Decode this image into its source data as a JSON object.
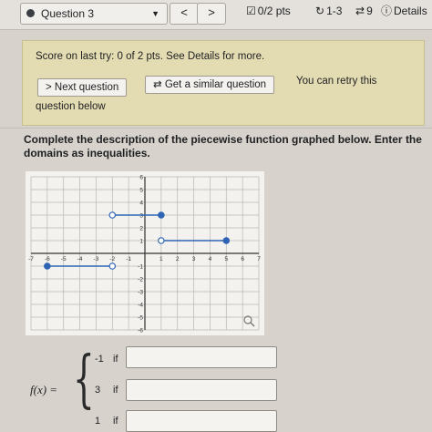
{
  "topbar": {
    "question_label": "Question 3",
    "prev_symbol": "<",
    "next_symbol": ">",
    "points": "0/2 pts",
    "attempts": "1-3",
    "retries": "9",
    "details": "Details"
  },
  "feedback": {
    "score_text": "Score on last try: 0 of 2 pts. See Details for more.",
    "next_question_label": "> Next question",
    "similar_question_label": "Get a similar question",
    "retry_text_line1": "You can retry this",
    "retry_text_line2": "question below"
  },
  "prompt": {
    "line1": "Complete the description of the piecewise function graphed below. Enter the",
    "line2": "domains as inequalities."
  },
  "graph": {
    "x_ticks": [
      "-7",
      "-6",
      "-5",
      "-4",
      "-3",
      "-2",
      "-1",
      "1",
      "2",
      "3",
      "4",
      "5",
      "6",
      "7"
    ],
    "y_ticks": [
      "6",
      "5",
      "4",
      "3",
      "2",
      "1",
      "-1",
      "-2",
      "-3",
      "-4",
      "-5",
      "-6"
    ]
  },
  "chart_data": {
    "type": "line",
    "xlim": [
      -7,
      7
    ],
    "ylim": [
      -6,
      6
    ],
    "grid": true,
    "segments": [
      {
        "x": [
          -6,
          -2
        ],
        "y": [
          -1,
          -1
        ],
        "left_closed": true,
        "right_closed": false
      },
      {
        "x": [
          -2,
          1
        ],
        "y": [
          3,
          3
        ],
        "left_closed": false,
        "right_closed": true
      },
      {
        "x": [
          1,
          5
        ],
        "y": [
          1,
          1
        ],
        "left_closed": false,
        "right_closed": true
      }
    ]
  },
  "piecewise": {
    "fx_label": "f(x) =",
    "rows": [
      {
        "value": "-1",
        "if_label": "if"
      },
      {
        "value": "3",
        "if_label": "if"
      },
      {
        "value": "1",
        "if_label": "if"
      }
    ]
  },
  "colors": {
    "accent": "#2e64b4",
    "feedback_bg": "#e3dcb2"
  }
}
